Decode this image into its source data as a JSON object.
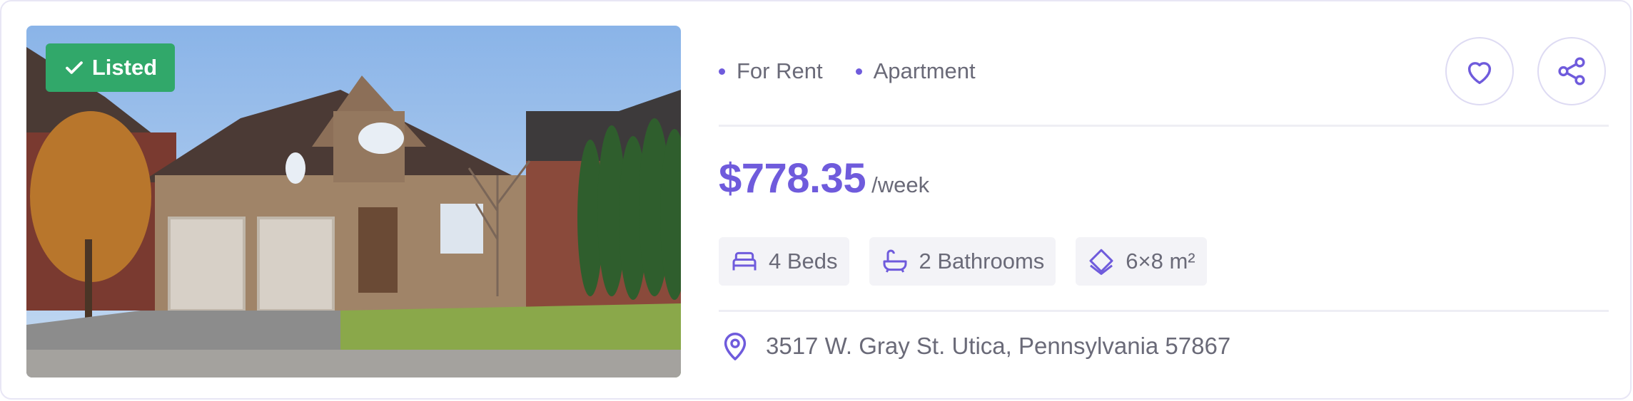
{
  "listing": {
    "badge": "Listed",
    "tags": [
      "For Rent",
      "Apartment"
    ],
    "price": "$778.35",
    "period": "/week",
    "features": [
      {
        "icon": "bed-icon",
        "label": "4 Beds"
      },
      {
        "icon": "bathtub-icon",
        "label": "2 Bathrooms"
      },
      {
        "icon": "area-icon",
        "label": "6×8 m²"
      }
    ],
    "address": "3517 W. Gray St. Utica, Pennsylvania 57867"
  },
  "actions": {
    "favorite_icon": "heart-icon",
    "share_icon": "share-icon"
  },
  "colors": {
    "accent": "#6f5bdc",
    "badge": "#31a86a",
    "text": "#6a6a78"
  }
}
